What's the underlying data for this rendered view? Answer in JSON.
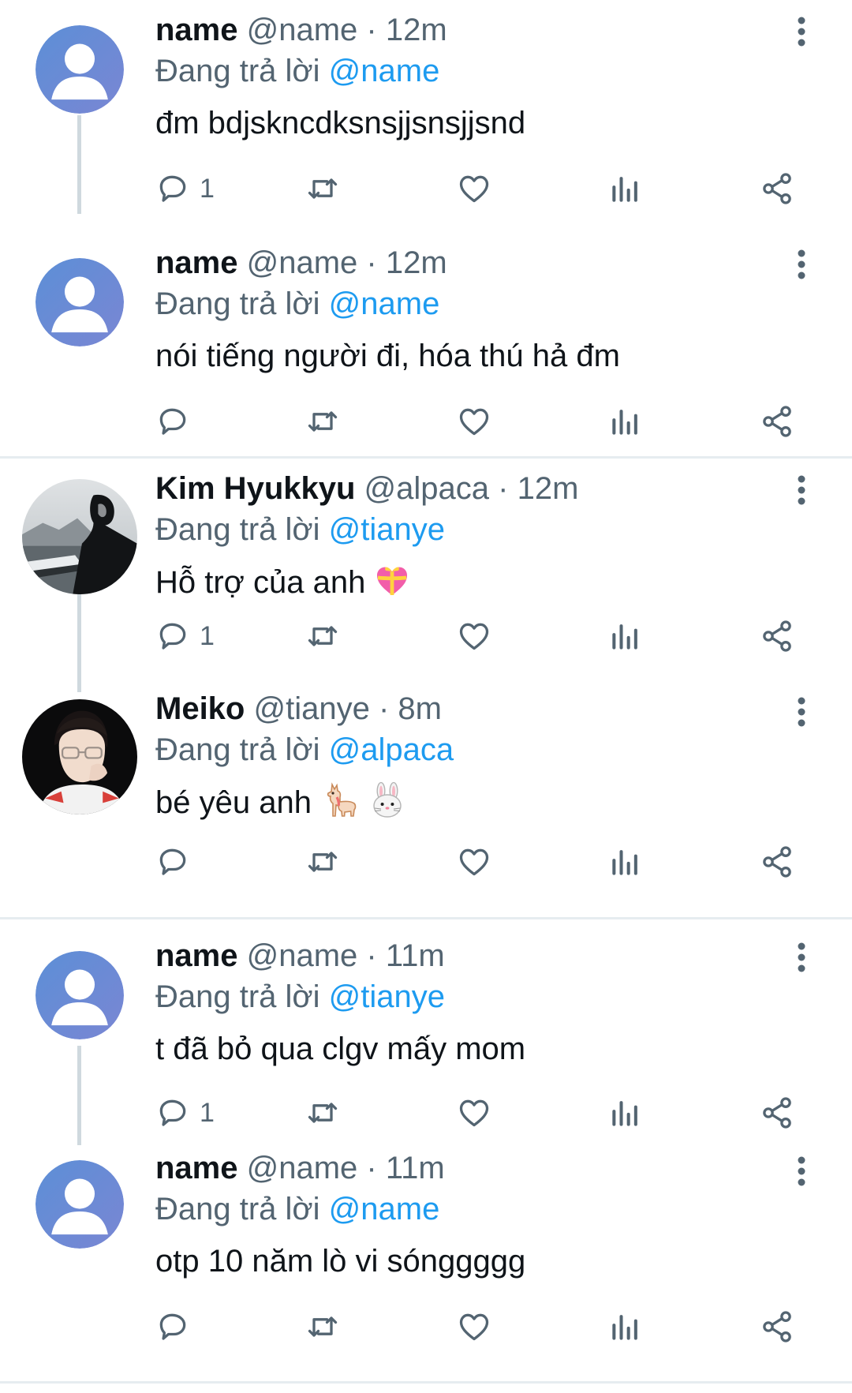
{
  "reply_prefix": "Đang trả lời",
  "tweets": [
    {
      "display_name": "name",
      "meta": "@name · 12m",
      "reply_to": "@name",
      "text": "đm bdjskncdksnsjjsnsjjsnd",
      "reply_count": "1",
      "avatar": "default-avatar"
    },
    {
      "display_name": "name",
      "meta": "@name · 12m",
      "reply_to": "@name",
      "text": "nói tiếng người đi, hóa thú hả đm",
      "reply_count": "",
      "avatar": "default-avatar"
    },
    {
      "display_name": "Kim Hyukkyu",
      "meta": "@alpaca · 12m",
      "reply_to": "@tianye",
      "text": "Hỗ trợ của anh",
      "emoji": [
        "gift-heart-emoji"
      ],
      "reply_count": "1",
      "avatar": "photo-avatar-boat"
    },
    {
      "display_name": "Meiko",
      "meta": "@tianye · 8m",
      "reply_to": "@alpaca",
      "text": "bé yêu anh",
      "emoji": [
        "llama-emoji",
        "rabbit-emoji"
      ],
      "reply_count": "",
      "avatar": "photo-avatar-glasses"
    },
    {
      "display_name": "name",
      "meta": "@name · 11m",
      "reply_to": "@tianye",
      "text": "t đã bỏ qua clgv mấy mom",
      "reply_count": "1",
      "avatar": "default-avatar"
    },
    {
      "display_name": "name",
      "meta": "@name · 11m",
      "reply_to": "@name",
      "text": "otp 10 năm lò vi sónggggg",
      "reply_count": "",
      "avatar": "default-avatar"
    }
  ],
  "icons": {
    "reply": "speech-bubble-icon",
    "retweet": "retweet-icon",
    "like": "heart-icon",
    "views": "bar-chart-icon",
    "share": "share-icon",
    "more": "vertical-dots-icon"
  },
  "colors": {
    "mention": "#1d9bf0",
    "secondary_text": "#536471",
    "thread_line": "#cfd9de",
    "divider": "#e6ecf0",
    "default_avatar_bg": "#6a8ed6"
  }
}
